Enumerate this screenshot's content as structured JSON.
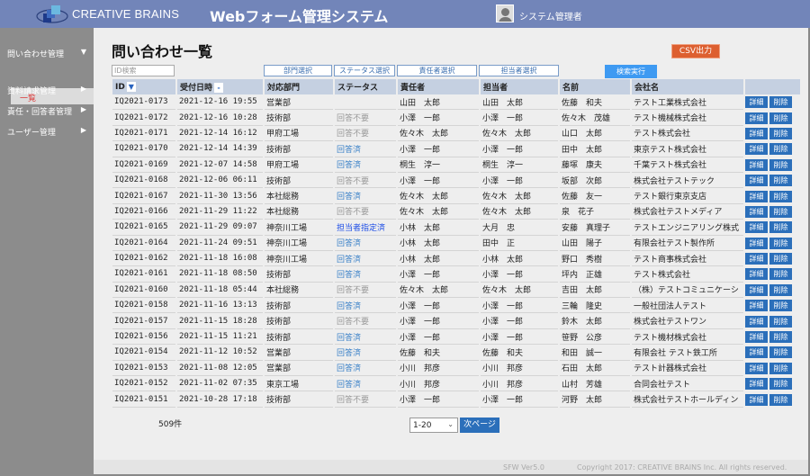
{
  "header": {
    "brand": "CREATIVE BRAINS",
    "title": "Webフォーム管理システム",
    "user": "システム管理者"
  },
  "sidebar": {
    "items": [
      {
        "label": "問い合わせ管理",
        "arrow": "▼"
      },
      {
        "label": "資料請求管理",
        "arrow": "▶"
      },
      {
        "label": "責任・回答者管理",
        "arrow": "▶"
      },
      {
        "label": "ユーザー管理",
        "arrow": "▶"
      }
    ],
    "sub_active": "一覧"
  },
  "page": {
    "title": "問い合わせ一覧",
    "csv": "CSV出力",
    "id_placeholder": "ID検索",
    "filters": [
      "部門選択",
      "ステータス選択",
      "責任者選択",
      "担当者選択"
    ],
    "search": "検索実行"
  },
  "table": {
    "headers": [
      "ID",
      "受付日時",
      "対応部門",
      "ステータス",
      "責任者",
      "担当者",
      "名前",
      "会社名"
    ],
    "sort_id": "▼",
    "sort_date": "-",
    "detail_label": "詳細",
    "delete_label": "削除",
    "rows": [
      [
        "IQ2021-0173",
        "2021-12-16 19:55",
        "営業部",
        "",
        "山田　太郎",
        "山田　太郎",
        "佐藤　和夫",
        "テスト工業株式会社"
      ],
      [
        "IQ2021-0172",
        "2021-12-16 10:28",
        "技術部",
        "回答不要",
        "小澤　一郎",
        "小澤　一郎",
        "佐々木　茂雄",
        "テスト機械株式会社"
      ],
      [
        "IQ2021-0171",
        "2021-12-14 16:12",
        "甲府工場",
        "回答不要",
        "佐々木　太郎",
        "佐々木　太郎",
        "山口　太郎",
        "テスト株式会社"
      ],
      [
        "IQ2021-0170",
        "2021-12-14 14:39",
        "技術部",
        "回答済",
        "小澤　一郎",
        "小澤　一郎",
        "田中　太郎",
        "東京テスト株式会社"
      ],
      [
        "IQ2021-0169",
        "2021-12-07 14:58",
        "甲府工場",
        "回答済",
        "桐生　淳一",
        "桐生　淳一",
        "藤塚　康夫",
        "千葉テスト株式会社"
      ],
      [
        "IQ2021-0168",
        "2021-12-06 06:11",
        "技術部",
        "回答不要",
        "小澤　一郎",
        "小澤　一郎",
        "坂部　次郎",
        "株式会社テストテック"
      ],
      [
        "IQ2021-0167",
        "2021-11-30 13:56",
        "本社総務",
        "回答済",
        "佐々木　太郎",
        "佐々木　太郎",
        "佐藤　友一",
        "テスト銀行東京支店"
      ],
      [
        "IQ2021-0166",
        "2021-11-29 11:22",
        "本社総務",
        "回答不要",
        "佐々木　太郎",
        "佐々木　太郎",
        "泉　花子",
        "株式会社テストメディア"
      ],
      [
        "IQ2021-0165",
        "2021-11-29 09:07",
        "神奈川工場",
        "担当者指定済",
        "小林　太郎",
        "大月　忠",
        "安藤　真理子",
        "テストエンジニアリング株式"
      ],
      [
        "IQ2021-0164",
        "2021-11-24 09:51",
        "神奈川工場",
        "回答済",
        "小林　太郎",
        "田中　正",
        "山田　陽子",
        "有限会社テスト製作所"
      ],
      [
        "IQ2021-0162",
        "2021-11-18 16:08",
        "神奈川工場",
        "回答済",
        "小林　太郎",
        "小林　太郎",
        "野口　秀樹",
        "テスト商事株式会社"
      ],
      [
        "IQ2021-0161",
        "2021-11-18 08:50",
        "技術部",
        "回答済",
        "小澤　一郎",
        "小澤　一郎",
        "坪内　正雄",
        "テスト株式会社"
      ],
      [
        "IQ2021-0160",
        "2021-11-18 05:44",
        "本社総務",
        "回答不要",
        "佐々木　太郎",
        "佐々木　太郎",
        "吉田　太郎",
        "（株）テストコミュニケーシ"
      ],
      [
        "IQ2021-0158",
        "2021-11-16 13:13",
        "技術部",
        "回答済",
        "小澤　一郎",
        "小澤　一郎",
        "三輪　隆史",
        "一般社団法人テスト"
      ],
      [
        "IQ2021-0157",
        "2021-11-15 18:28",
        "技術部",
        "回答不要",
        "小澤　一郎",
        "小澤　一郎",
        "鈴木　太郎",
        "株式会社テストワン"
      ],
      [
        "IQ2021-0156",
        "2021-11-15 11:21",
        "技術部",
        "回答済",
        "小澤　一郎",
        "小澤　一郎",
        "笹野　公彦",
        "テスト機材株式会社"
      ],
      [
        "IQ2021-0154",
        "2021-11-12 10:52",
        "営業部",
        "回答済",
        "佐藤　和夫",
        "佐藤　和夫",
        "和田　誠一",
        "有限会社 テスト鉄工所"
      ],
      [
        "IQ2021-0153",
        "2021-11-08 12:05",
        "営業部",
        "回答済",
        "小川　邦彦",
        "小川　邦彦",
        "石田　太郎",
        "テスト計器株式会社"
      ],
      [
        "IQ2021-0152",
        "2021-11-02 07:35",
        "東京工場",
        "回答済",
        "小川　邦彦",
        "小川　邦彦",
        "山村　芳雄",
        "合同会社テスト"
      ],
      [
        "IQ2021-0151",
        "2021-10-28 17:18",
        "技術部",
        "回答不要",
        "小澤　一郎",
        "小澤　一郎",
        "河野　太郎",
        "株式会社テストホールディン"
      ]
    ]
  },
  "pager": {
    "count": "509件",
    "range": "1-20",
    "next": "次ページ"
  },
  "footer": {
    "version": "SFW Ver5.0",
    "copyright": "Copyright 2017: CREATIVE BRAINS Inc. All rights reserved."
  },
  "colors": {
    "header": "#7285b9",
    "sidebar": "#8c8c8c",
    "csv": "#dd5f30",
    "search": "#3e9af2",
    "button": "#2b6fba",
    "status_done": "#3c82c8",
    "status_unneeded": "#999999",
    "status_assigned": "#1e4ee6"
  }
}
